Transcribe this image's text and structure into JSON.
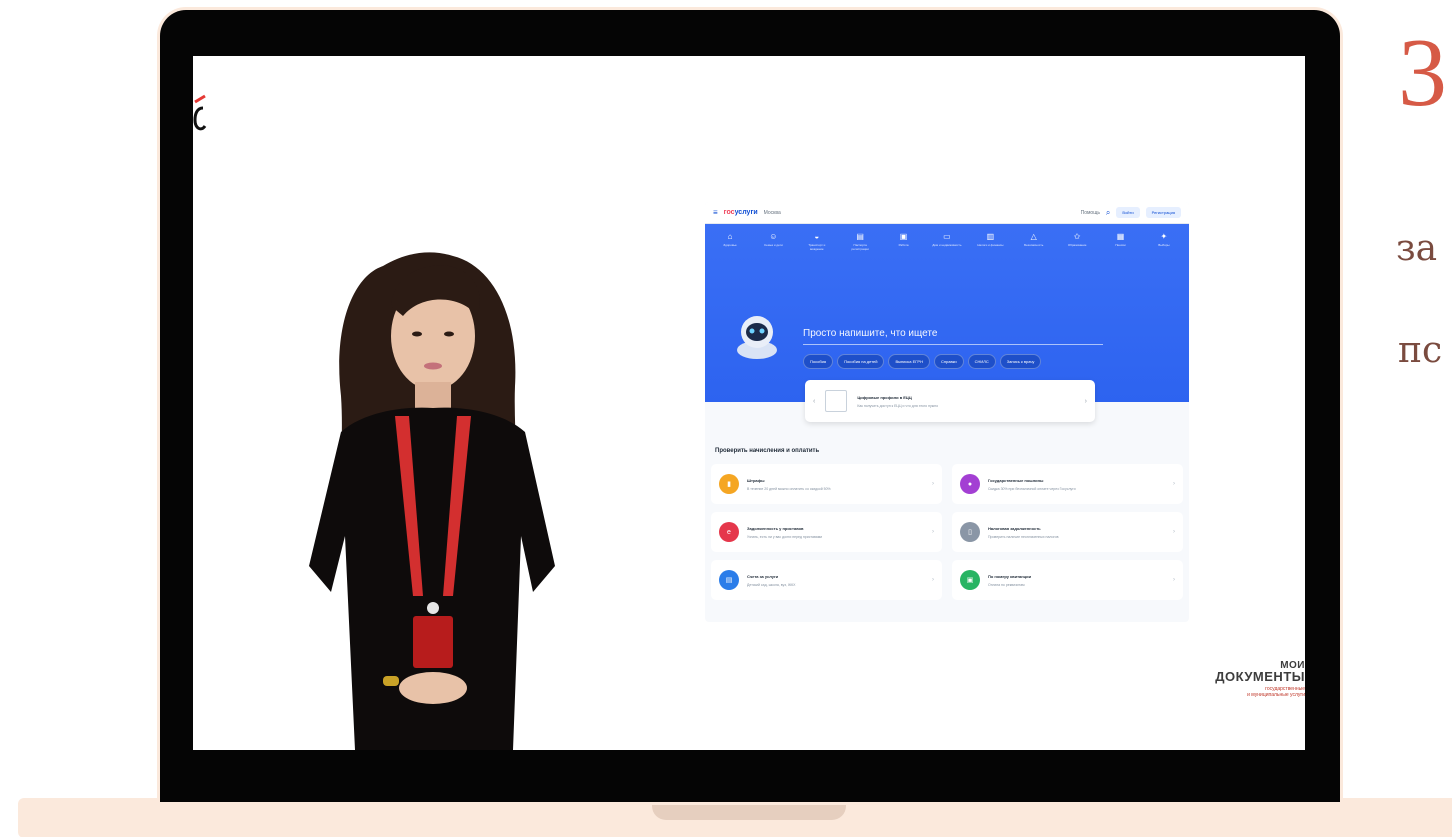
{
  "side": {
    "digit": "3",
    "line1": "за",
    "line2": "пс"
  },
  "gosuslugi": {
    "logo_a": "гос",
    "logo_b": "услуги",
    "location": "Москва",
    "help": "Помощь",
    "login": "Войти",
    "register": "Регистрация",
    "categories": [
      {
        "icon": "home-icon",
        "label": "Здоровье"
      },
      {
        "icon": "family-icon",
        "label": "Семья и дети"
      },
      {
        "icon": "car-icon",
        "label": "Транспорт и вождение"
      },
      {
        "icon": "document-icon",
        "label": "Паспорта регистрации"
      },
      {
        "icon": "briefcase-icon",
        "label": "Работа"
      },
      {
        "icon": "building-icon",
        "label": "Дом и недвижимость"
      },
      {
        "icon": "chart-icon",
        "label": "Налоги и финансы"
      },
      {
        "icon": "shield-icon",
        "label": "Безопасность"
      },
      {
        "icon": "star-icon",
        "label": "Образование"
      },
      {
        "icon": "gear-icon",
        "label": "Пенсии"
      },
      {
        "icon": "flag-icon",
        "label": "Выборы"
      }
    ],
    "prompt": "Просто напишите, что ищете",
    "chips": [
      "Пособия",
      "Пособия на детей",
      "Выписка ЕГРН",
      "Справки",
      "СНИЛС",
      "Запись к врачу"
    ],
    "banner": {
      "title": "Цифровые профили в ЕЦЦ",
      "text": "Как получить доступ к ЕЦЦ и что для этого нужно"
    },
    "section_title": "Проверить начисления и оплатить",
    "cards": [
      {
        "title": "Штрафы",
        "text": "В течение 20 дней можно оплатить со скидкой 50%",
        "color": "#f5a623",
        "icon": "fine-icon"
      },
      {
        "title": "Государственные пошлины",
        "text": "Скидка 30% при безналичной оплате через Госуслуги",
        "color": "#a33fd3",
        "icon": "coin-icon"
      },
      {
        "title": "Задолженность у приставов",
        "text": "Узнать, есть ли у вас долги перед приставами",
        "color": "#e5374b",
        "icon": "debt-icon"
      },
      {
        "title": "Налоговая задолженность",
        "text": "Проверить наличие неоплаченных налогов",
        "color": "#8a96a6",
        "icon": "tax-icon"
      },
      {
        "title": "Счета за услуги",
        "text": "Детский сад, школа, вуз, ЖКХ",
        "color": "#2b7de9",
        "icon": "invoice-icon"
      },
      {
        "title": "По номеру квитанции",
        "text": "Оплата по реквизитам",
        "color": "#28b463",
        "icon": "receipt-icon"
      }
    ]
  },
  "watermark": {
    "top": "МОИ",
    "main": "ДОКУМЕНТЫ",
    "sub1": "государственные",
    "sub2": "и муниципальные услуги"
  }
}
